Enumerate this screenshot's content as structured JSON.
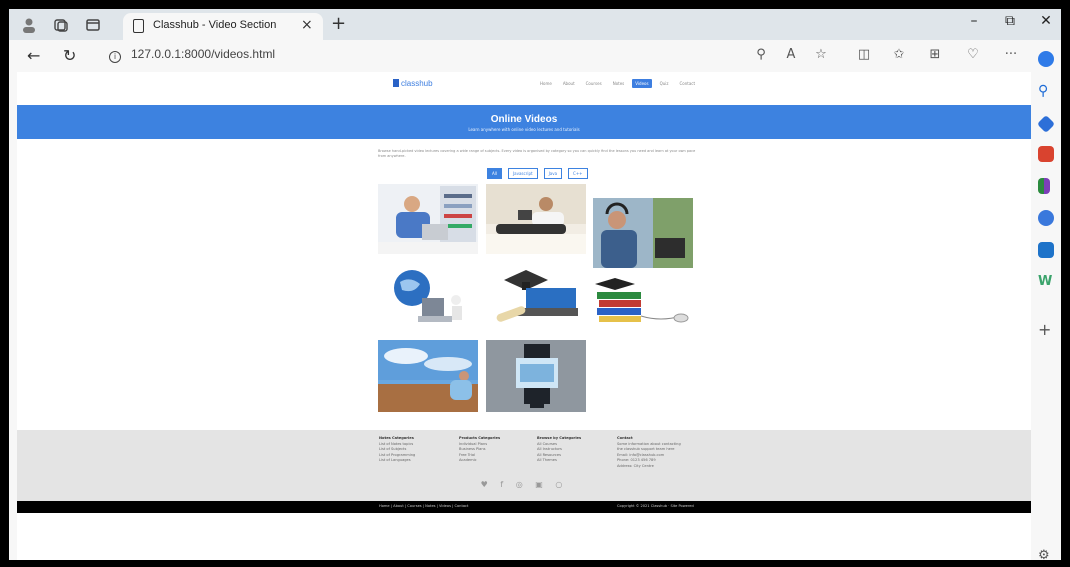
{
  "browser": {
    "tab_title": "Classhub - Video Section",
    "tab_close": "×",
    "new_tab": "+",
    "url": "127.0.0.1:8000/videos.html",
    "window_controls": {
      "minimize": "–",
      "restore": "⧉",
      "close": "✕"
    },
    "more_menu": "···"
  },
  "site": {
    "logo": "classhub",
    "nav": [
      "Home",
      "About",
      "Courses",
      "Notes",
      "Videos",
      "Quiz",
      "Contact"
    ],
    "active_nav": "Videos",
    "banner_title": "Online Videos",
    "banner_subtitle": "Learn anywhere with online video lectures and tutorials",
    "intro": "Browse hand-picked video lectures covering a wide range of subjects. Every video is organised by category so you can quickly find the lessons you need and learn at your own pace from anywhere.",
    "filters": [
      "All",
      "Javascript",
      "Java",
      "C++"
    ],
    "active_filter": "All",
    "footer": {
      "columns": [
        {
          "heading": "Notes Categories",
          "items": [
            "List of Notes topics",
            "List of Subjects",
            "List of Programming",
            "List of Languages"
          ]
        },
        {
          "heading": "Products Categories",
          "items": [
            "Individual Plans",
            "Business Plans",
            "Free Trial",
            "Academic"
          ]
        },
        {
          "heading": "Browse by Categories",
          "items": [
            "All Courses",
            "All Instructors",
            "All Resources",
            "All Themes"
          ]
        },
        {
          "heading": "Contact",
          "items": [
            "Some information about contacting",
            "the classhub support team here",
            "Email: info@classhub.com",
            "Phone: 0123 456 789",
            "Address: City Centre"
          ]
        }
      ],
      "social_icons": [
        "twitter-icon",
        "facebook-icon",
        "instagram-icon",
        "linkedin-icon",
        "github-icon"
      ],
      "social_glyphs": "♥ f ◎ ▣ ○"
    },
    "bottom_links": "Home | About | Courses | Notes | Videos | Contact",
    "copyright": "Copyright © 2021 Classhub · Site Powered"
  },
  "colors": {
    "accent": "#3d82e0",
    "tabbar": "#dfe5ea",
    "footer": "#e4e4e4"
  }
}
